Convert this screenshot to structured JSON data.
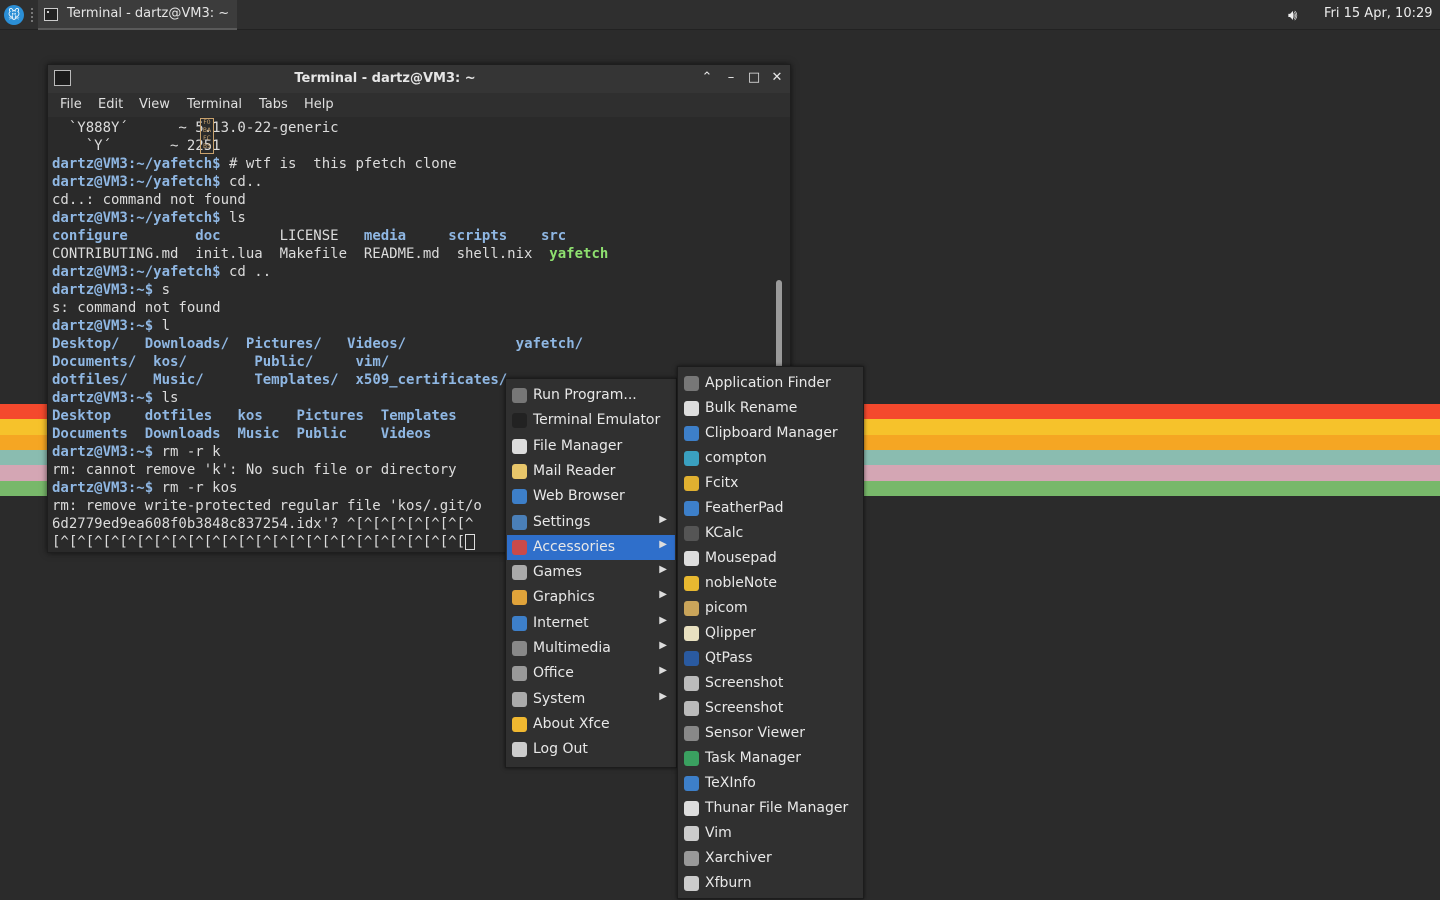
{
  "colors": {
    "stripes": [
      "#f4492d",
      "#f6c22b",
      "#f5a623",
      "#8abcb0",
      "#d4a6b4",
      "#78b86a"
    ]
  },
  "panel": {
    "task_title": "Terminal - dartz@VM3: ~",
    "volume_icon": "volume-icon",
    "clock": "Fri 15 Apr, 10:29"
  },
  "terminal": {
    "title": "Terminal - dartz@VM3: ~",
    "menu": [
      "File",
      "Edit",
      "View",
      "Terminal",
      "Tabs",
      "Help"
    ],
    "lines": [
      {
        "html": "  `Y888Y´      ~ 5.13.0-22-generic"
      },
      {
        "html": "    `Y´       ~ 2251"
      },
      {
        "prompt": "dartz@VM3:~/yafetch$",
        "text": " # wtf is  this pfetch clone"
      },
      {
        "prompt": "dartz@VM3:~/yafetch$",
        "text": " cd.."
      },
      {
        "text": "cd..: command not found"
      },
      {
        "prompt": "dartz@VM3:~/yafetch$",
        "text": " ls"
      },
      {
        "cols": [
          [
            "configure",
            "dir"
          ],
          [
            "        "
          ],
          [
            "doc",
            "dir"
          ],
          [
            "       LICENSE   "
          ],
          [
            "media",
            "dir"
          ],
          [
            "     "
          ],
          [
            "scripts",
            "dir"
          ],
          [
            "    "
          ],
          [
            "src",
            "dir"
          ]
        ]
      },
      {
        "cols": [
          [
            "CONTRIBUTING.md  init.lua  Makefile  README.md  shell.nix  "
          ],
          [
            "yafetch",
            "exe"
          ]
        ]
      },
      {
        "prompt": "dartz@VM3:~/yafetch$",
        "text": " cd .."
      },
      {
        "prompt": "dartz@VM3:~$",
        "text": " s"
      },
      {
        "text": "s: command not found"
      },
      {
        "prompt": "dartz@VM3:~$",
        "text": " l"
      },
      {
        "cols": [
          [
            "Desktop/",
            "dir"
          ],
          [
            "   "
          ],
          [
            "Downloads/",
            "dir"
          ],
          [
            "  "
          ],
          [
            "Pictures/",
            "dir"
          ],
          [
            "   "
          ],
          [
            "Videos/",
            "dir"
          ],
          [
            "             "
          ],
          [
            "yafetch/",
            "dir"
          ]
        ]
      },
      {
        "cols": [
          [
            "Documents/",
            "dir"
          ],
          [
            "  "
          ],
          [
            "kos/",
            "dir"
          ],
          [
            "        "
          ],
          [
            "Public/",
            "dir"
          ],
          [
            "     "
          ],
          [
            "vim/",
            "dir"
          ]
        ]
      },
      {
        "cols": [
          [
            "dotfiles/",
            "dir"
          ],
          [
            "   "
          ],
          [
            "Music/",
            "dir"
          ],
          [
            "      "
          ],
          [
            "Templates/",
            "dir"
          ],
          [
            "  "
          ],
          [
            "x509_certificates/",
            "dir"
          ]
        ]
      },
      {
        "prompt": "dartz@VM3:~$",
        "text": " ls"
      },
      {
        "cols": [
          [
            "Desktop",
            "dir"
          ],
          [
            "    "
          ],
          [
            "dotfiles",
            "dir"
          ],
          [
            "   "
          ],
          [
            "kos",
            "dir"
          ],
          [
            "    "
          ],
          [
            "Pictures",
            "dir"
          ],
          [
            "  "
          ],
          [
            "Templates",
            "dir"
          ]
        ]
      },
      {
        "cols": [
          [
            "Documents",
            "dir"
          ],
          [
            "  "
          ],
          [
            "Downloads",
            "dir"
          ],
          [
            "  "
          ],
          [
            "Music",
            "dir"
          ],
          [
            "  "
          ],
          [
            "Public",
            "dir"
          ],
          [
            "    "
          ],
          [
            "Videos",
            "dir"
          ]
        ]
      },
      {
        "prompt": "dartz@VM3:~$",
        "text": " rm -r k"
      },
      {
        "text": "rm: cannot remove 'k': No such file or directory"
      },
      {
        "prompt": "dartz@VM3:~$",
        "text": " rm -r kos"
      },
      {
        "text": "rm: remove write-protected regular file 'kos/.git/o"
      },
      {
        "text": "6d2779ed9ea608f0b3848c837254.idx'? ^[^[^[^[^[^[^[^"
      },
      {
        "text": "[^[^[^[^[^[^[^[^[^[^[^[^[^[^[^[^[^[^[^[^[^[^[^[^[",
        "cursor": true
      }
    ]
  },
  "main_menu": [
    {
      "label": "Run Program...",
      "icon": "run-icon",
      "color": "#777",
      "sub": false
    },
    {
      "label": "Terminal Emulator",
      "icon": "terminal-icon",
      "color": "#222",
      "sub": false
    },
    {
      "label": "File Manager",
      "icon": "folder-icon",
      "color": "#ddd",
      "sub": false
    },
    {
      "label": "Mail Reader",
      "icon": "mail-icon",
      "color": "#e8c66a",
      "sub": false
    },
    {
      "label": "Web Browser",
      "icon": "globe-icon",
      "color": "#3d7fc9",
      "sub": false
    },
    {
      "label": "Settings",
      "icon": "settings-icon",
      "color": "#4a7fb8",
      "sub": true
    },
    {
      "label": "Accessories",
      "icon": "accessories-icon",
      "color": "#c94a4a",
      "sub": true,
      "active": true
    },
    {
      "label": "Games",
      "icon": "games-icon",
      "color": "#aaa",
      "sub": true
    },
    {
      "label": "Graphics",
      "icon": "graphics-icon",
      "color": "#e0a33a",
      "sub": true
    },
    {
      "label": "Internet",
      "icon": "internet-icon",
      "color": "#3d7fc9",
      "sub": true
    },
    {
      "label": "Multimedia",
      "icon": "multimedia-icon",
      "color": "#888",
      "sub": true
    },
    {
      "label": "Office",
      "icon": "office-icon",
      "color": "#999",
      "sub": true
    },
    {
      "label": "System",
      "icon": "system-icon",
      "color": "#aaa",
      "sub": true
    },
    {
      "label": "About Xfce",
      "icon": "star-icon",
      "color": "#f0b830",
      "sub": false
    },
    {
      "label": "Log Out",
      "icon": "power-icon",
      "color": "#ccc",
      "sub": false
    }
  ],
  "accessories_menu": [
    {
      "label": "Application Finder",
      "icon": "search-icon",
      "color": "#777"
    },
    {
      "label": "Bulk Rename",
      "icon": "folder-icon",
      "color": "#ddd"
    },
    {
      "label": "Clipboard Manager",
      "icon": "clipboard-icon",
      "color": "#3d7fc9"
    },
    {
      "label": "compton",
      "icon": "gear-icon",
      "color": "#3aa0c0"
    },
    {
      "label": "Fcitx",
      "icon": "keyboard-icon",
      "color": "#e0b030"
    },
    {
      "label": "FeatherPad",
      "icon": "feather-icon",
      "color": "#3d7fc9"
    },
    {
      "label": "KCalc",
      "icon": "calculator-icon",
      "color": "#555"
    },
    {
      "label": "Mousepad",
      "icon": "text-editor-icon",
      "color": "#ddd"
    },
    {
      "label": "nobleNote",
      "icon": "note-icon",
      "color": "#e8b830"
    },
    {
      "label": "picom",
      "icon": "picom-icon",
      "color": "#c9a45a"
    },
    {
      "label": "Qlipper",
      "icon": "qlipper-icon",
      "color": "#e8e0c0"
    },
    {
      "label": "QtPass",
      "icon": "qtpass-icon",
      "color": "#2a5aa0"
    },
    {
      "label": "Screenshot",
      "icon": "camera-icon",
      "color": "#bbb"
    },
    {
      "label": "Screenshot",
      "icon": "camera-icon",
      "color": "#bbb"
    },
    {
      "label": "Sensor Viewer",
      "icon": "sensor-icon",
      "color": "#888"
    },
    {
      "label": "Task Manager",
      "icon": "task-manager-icon",
      "color": "#3aa060"
    },
    {
      "label": "TeXInfo",
      "icon": "info-icon",
      "color": "#3d7fc9"
    },
    {
      "label": "Thunar File Manager",
      "icon": "folder-icon",
      "color": "#ddd"
    },
    {
      "label": "Vim",
      "icon": "vim-icon",
      "color": "#ccc"
    },
    {
      "label": "Xarchiver",
      "icon": "archive-icon",
      "color": "#999"
    },
    {
      "label": "Xfburn",
      "icon": "disc-icon",
      "color": "#ccc"
    }
  ]
}
